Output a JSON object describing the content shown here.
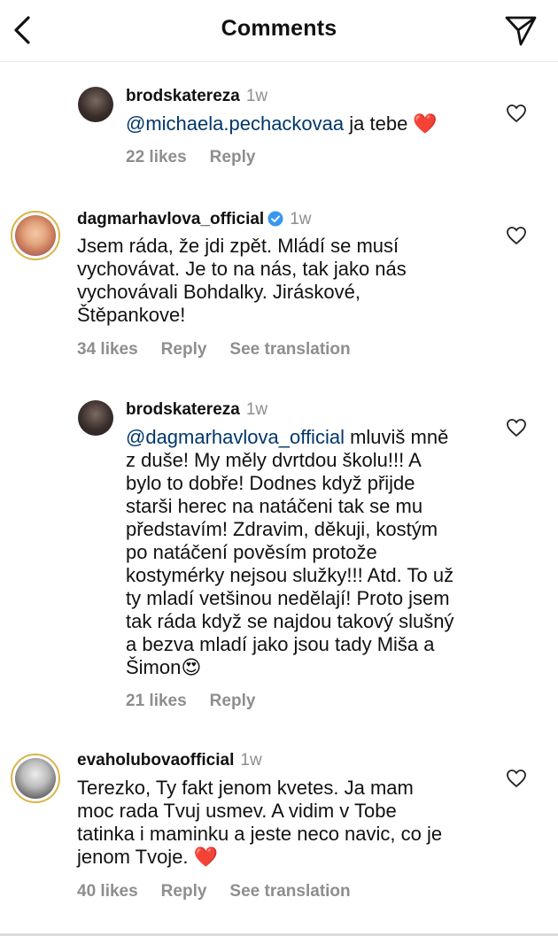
{
  "header": {
    "title": "Comments"
  },
  "comments": [
    {
      "username": "brodskatereza",
      "time": "1w",
      "mention": "@michaela.pechackovaa",
      "text": " ja tebe ",
      "emoji": "❤️",
      "likes": "22 likes",
      "reply": "Reply"
    },
    {
      "username": "dagmarhavlova_official",
      "time": "1w",
      "verified": true,
      "lines": [
        "Jsem ráda, že jdi zpět. Mládí se musí",
        "vychovávat. Je to na nás, tak jako nás",
        "vychovávali Bohdalky. Jiráskové,",
        "Štěpankove!"
      ],
      "likes": "34 likes",
      "reply": "Reply",
      "translation": "See translation"
    },
    {
      "username": "brodskatereza",
      "time": "1w",
      "mention": "@dagmarhavlova_official",
      "first_line_rest": " mluviš mně",
      "lines": [
        "z duše! My měly dvrtdou školu!!! A",
        "bylo to dobře! Dodnes když přijde",
        "starši herec na natáčeni tak se mu",
        "představím! Zdravim, děkuji, kostým",
        "po natáčení pověsím protože",
        "kostymérky nejsou služky!!! Atd. To už",
        "ty mladí vetšinou nedělají! Proto jsem",
        "tak ráda když se najdou takový slušný",
        "a bezva mladí jako jsou tady Miša a"
      ],
      "last_line": "Šimon",
      "emoji": "😍",
      "likes": "21 likes",
      "reply": "Reply"
    },
    {
      "username": "evaholubovaofficial",
      "time": "1w",
      "lines": [
        "Terezko, Ty fakt jenom kvetes. Ja mam",
        "moc rada Tvuj usmev. A vidim v Tobe",
        "tatinka i maminku a jeste neco navic, co je"
      ],
      "last_line": "jenom Tvoje. ",
      "emoji": "❤️",
      "likes": "40 likes",
      "reply": "Reply",
      "translation": "See translation"
    }
  ],
  "colors": {
    "accent_link": "#00376b",
    "muted": "#8e8e8e",
    "verified": "#3897f0"
  },
  "icons": [
    "back-arrow-icon",
    "send-icon",
    "heart-outline-icon",
    "verified-badge-icon"
  ]
}
